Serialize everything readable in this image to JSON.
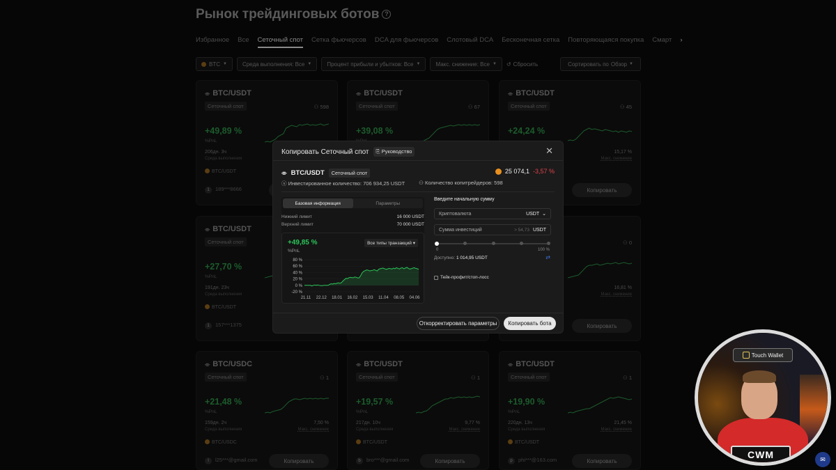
{
  "page": {
    "title": "Рынок трейдинговых ботов",
    "tabs": [
      "Избранное",
      "Все",
      "Сеточный спот",
      "Сетка фьючерсов",
      "DCA для фьючерсов",
      "Слотовый DCA",
      "Бесконечная сетка",
      "Повторяющаяся покупка",
      "Смарт"
    ],
    "active_tab": "Сеточный спот",
    "filters": {
      "coin": "BTC",
      "env": "Среда выполнения: Все",
      "pnl": "Процент прибыли и убытков: Все",
      "dd": "Макс. снижение: Все",
      "reset": "Сбросить",
      "sort_label": "Сортировать по",
      "sort_value": "Обзор"
    }
  },
  "cards": [
    {
      "pair": "BTC/USDT",
      "tag": "Сеточный спот",
      "users": "598",
      "pnl": "+49,89 %",
      "pnl_label": "%PnL",
      "dur": "206дн. 3ч",
      "dur_label": "Среда выполнения",
      "dd": "",
      "dd_label": "",
      "coin": "BTC/USDT",
      "owner_initial": "1",
      "owner": "189***8666",
      "copy": "Копировать"
    },
    {
      "pair": "BTC/USDT",
      "tag": "Сеточный спот",
      "users": "67",
      "pnl": "+39,08 %",
      "pnl_label": "%PnL",
      "dur": "",
      "dur_label": "",
      "dd": "",
      "dd_label": "",
      "coin": "",
      "owner_initial": "",
      "owner": "",
      "copy": ""
    },
    {
      "pair": "BTC/USDT",
      "tag": "Сеточный спот",
      "users": "45",
      "pnl": "+24,24 %",
      "pnl_label": "",
      "dur": "",
      "dur_label": "",
      "dd": "15,17 %",
      "dd_label": "Макс. снижение",
      "coin": "",
      "owner_initial": "",
      "owner": "",
      "copy": "Копировать"
    },
    {
      "pair": "BTC/USDT",
      "tag": "Сеточный спот",
      "users": "",
      "pnl": "+27,70 %",
      "pnl_label": "%PnL",
      "dur": "191дн. 23ч",
      "dur_label": "Среда выполнения",
      "dd": "",
      "dd_label": "",
      "coin": "BTC/USDT",
      "owner_initial": "1",
      "owner": "157***1375",
      "copy": ""
    },
    {
      "pair": "",
      "tag": "",
      "users": "",
      "pnl": "",
      "pnl_label": "",
      "dur": "",
      "dur_label": "",
      "dd": "",
      "dd_label": "",
      "coin": "",
      "owner_initial": "",
      "owner": "",
      "copy": ""
    },
    {
      "pair": "",
      "tag": "",
      "users": "0",
      "pnl": "",
      "pnl_label": "",
      "dur": "",
      "dur_label": "",
      "dd": "16,81 %",
      "dd_label": "Макс. снижение",
      "coin": "",
      "owner_initial": "",
      "owner": "",
      "copy": "Копировать"
    },
    {
      "pair": "BTC/USDC",
      "tag": "Сеточный спот",
      "users": "1",
      "pnl": "+21,48 %",
      "pnl_label": "%PnL",
      "dur": "159дн. 2ч",
      "dur_label": "Среда выполнения",
      "dd": "7,50 %",
      "dd_label": "Макс. снижение",
      "coin": "BTC/USDC",
      "owner_initial": "l",
      "owner": "l25***@gmail.com",
      "copy": "Копировать"
    },
    {
      "pair": "BTC/USDT",
      "tag": "Сеточный спот",
      "users": "1",
      "pnl": "+19,57 %",
      "pnl_label": "%PnL",
      "dur": "217дн. 10ч",
      "dur_label": "Среда выполнения",
      "dd": "9,77 %",
      "dd_label": "Макс. снижение",
      "coin": "BTC/USDT",
      "owner_initial": "b",
      "owner": "bro***@gmail.com",
      "copy": "Копировать"
    },
    {
      "pair": "BTC/USDT",
      "tag": "Сеточный спот",
      "users": "1",
      "pnl": "+19,90 %",
      "pnl_label": "%PnL",
      "dur": "220дн. 13ч",
      "dur_label": "Среда выполнения",
      "dd": "21,45 %",
      "dd_label": "Макс. снижение",
      "coin": "BTC/USDT",
      "owner_initial": "p",
      "owner": "phi***@163.com",
      "copy": "Копировать"
    }
  ],
  "modal": {
    "title": "Копировать Сеточный спот",
    "guide": "Руководство",
    "pair": "BTC/USDT",
    "pair_tag": "Сеточный спот",
    "price": "25 074,1",
    "change": "-3,57 %",
    "invested": "Инвестированное количество: 706 934,25 USDT",
    "copiers": "Количество копитрейдеров: 598",
    "seg_basic": "Базовая информация",
    "seg_params": "Параметры",
    "lower_label": "Нижний лимит",
    "lower_value": "16 000 USDT",
    "upper_label": "Верхний лимит",
    "upper_value": "70 000 USDT",
    "pnl": "+49,85 %",
    "pnl_label": "%PnL",
    "tx_types": "Все типы транзакций",
    "amount_label": "Введите начальную сумму",
    "crypto_label": "Криптовалюта",
    "crypto_value": "USDT",
    "invest_label": "Сумма инвестиций",
    "invest_min": "> 54,73",
    "invest_unit": "USDT",
    "slider_min": "0",
    "slider_max": "100 %",
    "available_label": "Доступно:",
    "available_value": "1 014,95 USDT",
    "tp_sl": "Тейк-профит/стоп-лосс",
    "btn_adjust": "Откорректировать параметры",
    "btn_copy": "Копировать бота"
  },
  "chart_data": {
    "type": "area",
    "x": [
      "21.11",
      "22.12",
      "18.01",
      "16.02",
      "15.03",
      "11.04",
      "08.05",
      "04.06"
    ],
    "y_ticks": [
      "80 %",
      "60 %",
      "40 %",
      "20 %",
      "0 %",
      "-20 %"
    ],
    "ylim": [
      -20,
      80
    ],
    "series": [
      {
        "values": [
          0,
          0,
          0,
          0,
          0,
          -2,
          0,
          1,
          0,
          1,
          0,
          -1,
          -1,
          0,
          0,
          0,
          0,
          3,
          5,
          4,
          6,
          5,
          7,
          8,
          6,
          9,
          14,
          18,
          22,
          21,
          24,
          25,
          24,
          24,
          26,
          25,
          23,
          24,
          31,
          40,
          44,
          46,
          48,
          47,
          45,
          46,
          47,
          49,
          47,
          45,
          50,
          52,
          53,
          54,
          52,
          50,
          51,
          53,
          52,
          51,
          54,
          52,
          55,
          53,
          51,
          54,
          55,
          52,
          54,
          56,
          53,
          51,
          52,
          54,
          55,
          53,
          52,
          50
        ]
      }
    ],
    "color": "#2bc559"
  },
  "webcam": {
    "sign": "Touch Wallet",
    "logo": "CWM"
  }
}
